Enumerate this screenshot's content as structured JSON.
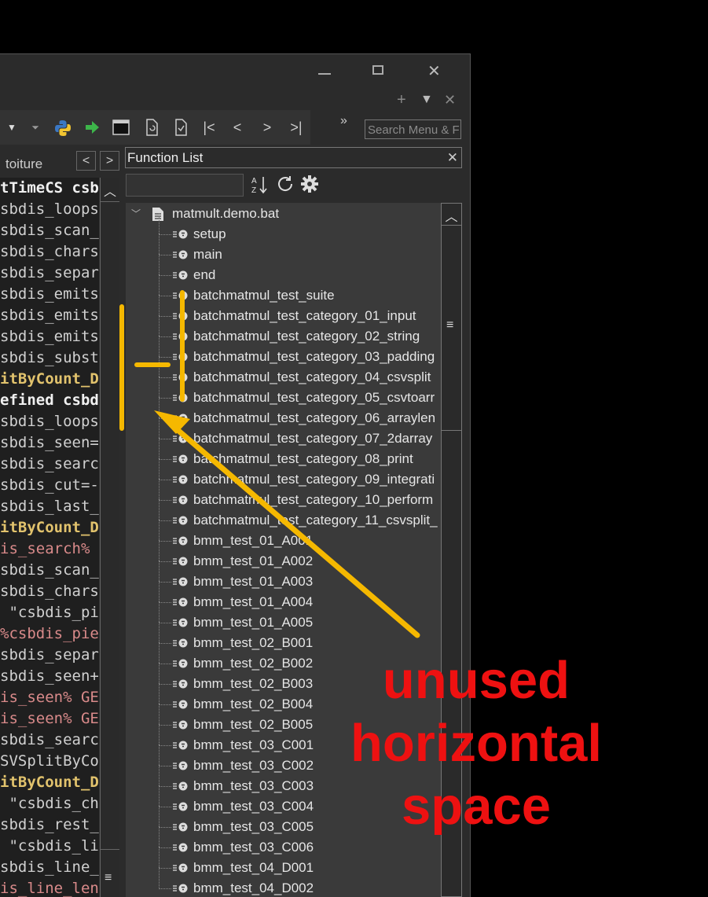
{
  "window": {
    "minimize_icon": "minimize-icon",
    "maximize_icon": "maximize-icon",
    "close_icon": "close-icon"
  },
  "panel_controls": {
    "plus": "+",
    "dropdown": "▼",
    "close": "✕"
  },
  "toolbar": {
    "more": "»",
    "search_placeholder": "Search Menu & F"
  },
  "editor": {
    "tab_label": "toiture",
    "lines": [
      {
        "text": "tTimeCS csb",
        "style": "w"
      },
      {
        "text": "sbdis_loops",
        "style": ""
      },
      {
        "text": "sbdis_scan_",
        "style": ""
      },
      {
        "text": "sbdis_chars",
        "style": ""
      },
      {
        "text": "sbdis_separ",
        "style": ""
      },
      {
        "text": "sbdis_emits",
        "style": ""
      },
      {
        "text": "sbdis_emits",
        "style": ""
      },
      {
        "text": "sbdis_emits",
        "style": ""
      },
      {
        "text": "sbdis_subst",
        "style": ""
      },
      {
        "text": "itByCount_D",
        "style": "y"
      },
      {
        "text": "efined csbd",
        "style": "w"
      },
      {
        "text": "sbdis_loops",
        "style": ""
      },
      {
        "text": "sbdis_seen=",
        "style": ""
      },
      {
        "text": "sbdis_searc",
        "style": ""
      },
      {
        "text": "sbdis_cut=-",
        "style": ""
      },
      {
        "text": "sbdis_last_",
        "style": ""
      },
      {
        "text": "itByCount_D",
        "style": "y"
      },
      {
        "text": "is_search%",
        "style": "r"
      },
      {
        "text": "sbdis_scan_",
        "style": ""
      },
      {
        "text": "sbdis_chars",
        "style": ""
      },
      {
        "text": " \"csbdis_pi",
        "style": ""
      },
      {
        "text": "%csbdis_pie",
        "style": "r"
      },
      {
        "text": "sbdis_separ",
        "style": ""
      },
      {
        "text": "sbdis_seen+",
        "style": ""
      },
      {
        "text": "is_seen% GE",
        "style": "r"
      },
      {
        "text": "is_seen% GE",
        "style": "r"
      },
      {
        "text": "sbdis_searc",
        "style": ""
      },
      {
        "text": "SVSplitByCo",
        "style": ""
      },
      {
        "text": "itByCount_D",
        "style": "y"
      },
      {
        "text": " \"csbdis_ch",
        "style": ""
      },
      {
        "text": "sbdis_rest_",
        "style": ""
      },
      {
        "text": " \"csbdis_li",
        "style": ""
      },
      {
        "text": "sbdis_line_",
        "style": ""
      },
      {
        "text": "is_line_len",
        "style": "r"
      }
    ]
  },
  "function_list": {
    "title": "Function List",
    "file": "matmult.demo.bat",
    "functions": [
      "setup",
      "main",
      "end",
      "batchmatmul_test_suite",
      "batchmatmul_test_category_01_input",
      "batchmatmul_test_category_02_string",
      "batchmatmul_test_category_03_padding",
      "batchmatmul_test_category_04_csvsplit",
      "batchmatmul_test_category_05_csvtoarr",
      "batchmatmul_test_category_06_arraylen",
      "batchmatmul_test_category_07_2darray",
      "batchmatmul_test_category_08_print",
      "batchmatmul_test_category_09_integrati",
      "batchmatmul_test_category_10_perform",
      "batchmatmul_test_category_11_csvsplit_",
      "bmm_test_01_A001",
      "bmm_test_01_A002",
      "bmm_test_01_A003",
      "bmm_test_01_A004",
      "bmm_test_01_A005",
      "bmm_test_02_B001",
      "bmm_test_02_B002",
      "bmm_test_02_B003",
      "bmm_test_02_B004",
      "bmm_test_02_B005",
      "bmm_test_03_C001",
      "bmm_test_03_C002",
      "bmm_test_03_C003",
      "bmm_test_03_C004",
      "bmm_test_03_C005",
      "bmm_test_03_C006",
      "bmm_test_04_D001",
      "bmm_test_04_D002"
    ]
  },
  "annotation": {
    "line1": "unused",
    "line2": "horizontal",
    "line3": "space",
    "color": "#ee1111",
    "arrow_color": "#f5b800"
  }
}
